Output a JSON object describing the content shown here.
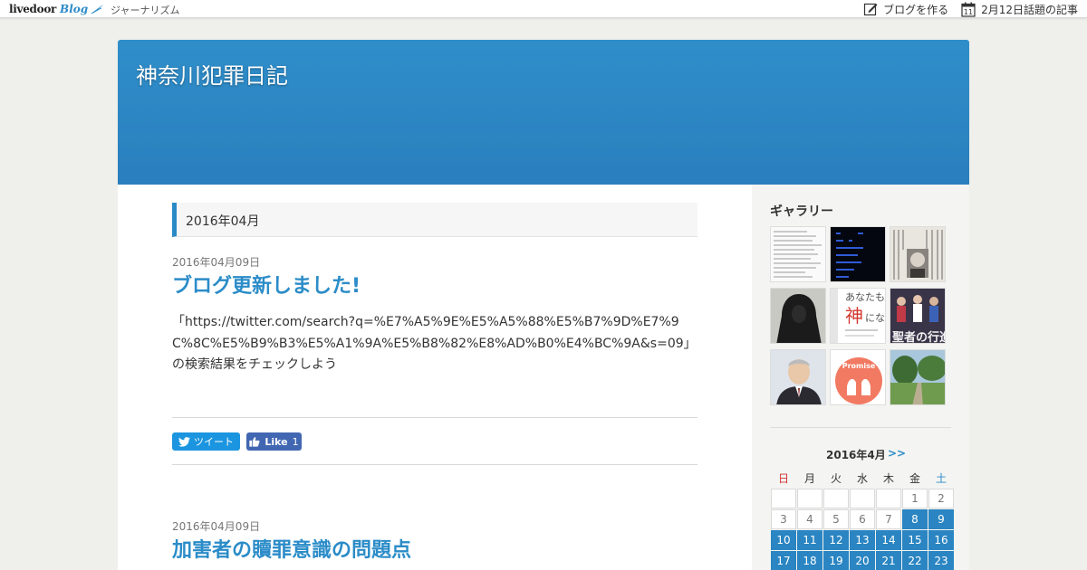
{
  "topbar": {
    "brand_main": "livedoor",
    "brand_blog": "Blog",
    "category": "ジャーナリズム",
    "create_blog": "ブログを作る",
    "calendar_day": "11",
    "topic_articles": "2月12日話題の記事"
  },
  "blog": {
    "title": "神奈川犯罪日記"
  },
  "archive": {
    "heading": "2016年04月"
  },
  "posts": [
    {
      "date": "2016年04月09日",
      "title": "ブログ更新しました!",
      "body": "「https://twitter.com/search?q=%E7%A5%9E%E5%A5%88%E5%B7%9D%E7%9C%8C%E5%B9%B3%E5%A1%9A%E5%B8%82%E8%AD%B0%E4%BC%9A&s=09」の検索結果をチェックしよう"
    },
    {
      "date": "2016年04月09日",
      "title": "加害者の贖罪意識の問題点"
    }
  ],
  "share": {
    "tweet_label": "ツイート",
    "like_label": "Like",
    "like_count": "1"
  },
  "sidebar": {
    "gallery_title": "ギャラリー",
    "thumb2_text": "あなたも",
    "thumb2_text_red": "神",
    "thumb2_text_tail": "にな",
    "thumb3_text": "聖者の行進",
    "thumb5_text": "Promise"
  },
  "calendar": {
    "heading": "2016年4月",
    "next": ">>",
    "weekdays": [
      "日",
      "月",
      "火",
      "水",
      "木",
      "金",
      "土"
    ],
    "weeks": [
      [
        "",
        "",
        "",
        "",
        "",
        "1",
        "2"
      ],
      [
        "3",
        "4",
        "5",
        "6",
        "7",
        "8",
        "9"
      ],
      [
        "10",
        "11",
        "12",
        "13",
        "14",
        "15",
        "16"
      ],
      [
        "17",
        "18",
        "19",
        "20",
        "21",
        "22",
        "23"
      ]
    ],
    "posted_days": [
      "8",
      "9",
      "10",
      "11",
      "12",
      "13",
      "14",
      "15",
      "16",
      "17",
      "18",
      "19",
      "20",
      "21",
      "22",
      "23"
    ]
  },
  "colors": {
    "accent": "#2b8cc8",
    "header": "#2f8ec9",
    "tweet": "#1b95e0",
    "facebook": "#4267b2",
    "sunday": "#d23232"
  }
}
